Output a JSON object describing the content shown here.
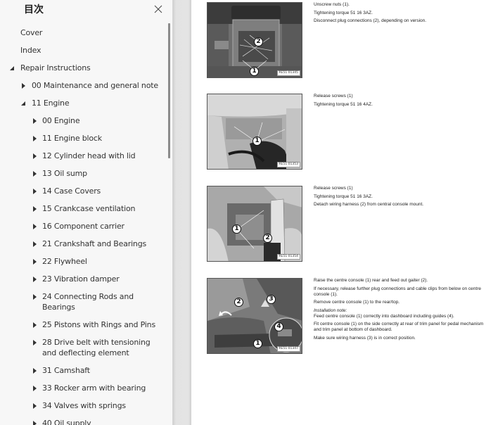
{
  "sidebar": {
    "title": "目次",
    "close_icon": "close-icon",
    "items": [
      {
        "label": "Cover",
        "level": 0,
        "state": "none"
      },
      {
        "label": "Index",
        "level": 0,
        "state": "none"
      },
      {
        "label": "Repair Instructions",
        "level": 0,
        "state": "expanded"
      },
      {
        "label": "00 Maintenance and general note",
        "level": 1,
        "state": "collapsed"
      },
      {
        "label": "11 Engine",
        "level": 1,
        "state": "expanded"
      },
      {
        "label": "00 Engine",
        "level": 2,
        "state": "collapsed"
      },
      {
        "label": "11 Engine block",
        "level": 2,
        "state": "collapsed"
      },
      {
        "label": "12 Cylinder head with lid",
        "level": 2,
        "state": "collapsed"
      },
      {
        "label": "13 Oil sump",
        "level": 2,
        "state": "collapsed"
      },
      {
        "label": "14 Case Covers",
        "level": 2,
        "state": "collapsed"
      },
      {
        "label": "15 Crankcase ventilation",
        "level": 2,
        "state": "collapsed"
      },
      {
        "label": "16 Component carrier",
        "level": 2,
        "state": "collapsed"
      },
      {
        "label": "21 Crankshaft and Bearings",
        "level": 2,
        "state": "collapsed"
      },
      {
        "label": "22 Flywheel",
        "level": 2,
        "state": "collapsed"
      },
      {
        "label": "23 Vibration damper",
        "level": 2,
        "state": "collapsed"
      },
      {
        "label": "24 Connecting Rods and Bearings",
        "level": 2,
        "state": "collapsed"
      },
      {
        "label": "25 Pistons with Rings and Pins",
        "level": 2,
        "state": "collapsed"
      },
      {
        "label": "28 Drive belt with tensioning and deflecting element",
        "level": 2,
        "state": "collapsed"
      },
      {
        "label": "31 Camshaft",
        "level": 2,
        "state": "collapsed"
      },
      {
        "label": "33 Rocker arm with bearing",
        "level": 2,
        "state": "collapsed"
      },
      {
        "label": "34 Valves with springs",
        "level": 2,
        "state": "collapsed"
      },
      {
        "label": "40 Oil supply",
        "level": 2,
        "state": "collapsed"
      }
    ]
  },
  "document": {
    "steps": [
      {
        "figure_code": "RE51 01345",
        "callouts": [
          "2",
          "1"
        ],
        "lines": [
          "Unscrew nuts (1).",
          "Tightening torque 51 16 3AZ.",
          "Disconnect plug connections (2), depending on version."
        ]
      },
      {
        "figure_code": "RE51 01353",
        "callouts": [
          "1"
        ],
        "lines": [
          "Release screws (1)",
          "Tightening torque 51 16 4AZ."
        ]
      },
      {
        "figure_code": "RE51 01354",
        "callouts": [
          "1",
          "2"
        ],
        "lines": [
          "Release screws (1)",
          "Tightening torque 51 16 3AZ.",
          "Detach wiring harness (2) from central console mount."
        ]
      },
      {
        "figure_code": "RE51 01347",
        "callouts": [
          "2",
          "3",
          "4",
          "1"
        ],
        "lines": [
          "Raise the centre console (1) rear and feed out gaiter (2).",
          "If necessary, release further plug connections and cable clips from below on centre console (1).",
          "Remove centre console (1) to the rear/top."
        ],
        "note_heading": "Installation note:",
        "note_lines": [
          "Feed centre console (1) correctly into dashboard including guides (4).",
          "Fit centre console (1) on the side correctly at rear of trim panel for pedal mechanism and trim panel at bottom of dashboard.",
          "Make sure wiring harness (3) is in correct position."
        ]
      }
    ]
  }
}
